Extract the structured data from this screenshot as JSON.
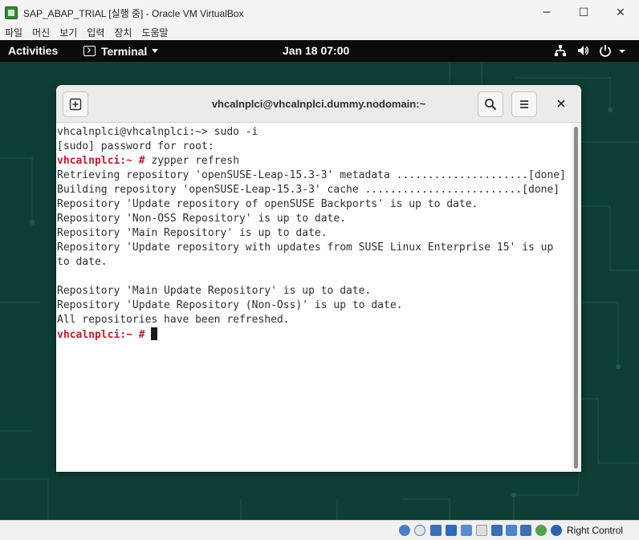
{
  "host_window": {
    "title": "SAP_ABAP_TRIAL [실행 중] - Oracle VM VirtualBox",
    "controls": {
      "minimize": "─",
      "maximize": "☐",
      "close": "✕"
    },
    "menu": [
      "파일",
      "머신",
      "보기",
      "입력",
      "장치",
      "도움말"
    ]
  },
  "gnome": {
    "activities": "Activities",
    "app_menu": "Terminal",
    "clock": "Jan 18  07:00"
  },
  "terminal": {
    "title": "vhcalnplci@vhcalnplci.dummy.nodomain:~",
    "lines": [
      {
        "prompt": "",
        "text": "vhcalnplci@vhcalnplci:~> sudo -i"
      },
      {
        "prompt": "",
        "text": "[sudo] password for root:"
      },
      {
        "prompt": "vhcalnplci:~ #",
        "text": " zypper refresh"
      },
      {
        "prompt": "",
        "text": "Retrieving repository 'openSUSE-Leap-15.3-3' metadata .....................[done]"
      },
      {
        "prompt": "",
        "text": "Building repository 'openSUSE-Leap-15.3-3' cache .........................[done]"
      },
      {
        "prompt": "",
        "text": "Repository 'Update repository of openSUSE Backports' is up to date."
      },
      {
        "prompt": "",
        "text": "Repository 'Non-OSS Repository' is up to date."
      },
      {
        "prompt": "",
        "text": "Repository 'Main Repository' is up to date."
      },
      {
        "prompt": "",
        "text": "Repository 'Update repository with updates from SUSE Linux Enterprise 15' is up"
      },
      {
        "prompt": "",
        "text": "to date."
      },
      {
        "prompt": "",
        "text": ""
      },
      {
        "prompt": "",
        "text": "Repository 'Main Update Repository' is up to date."
      },
      {
        "prompt": "",
        "text": "Repository 'Update Repository (Non-Oss)' is up to date."
      },
      {
        "prompt": "",
        "text": "All repositories have been refreshed."
      },
      {
        "prompt": "vhcalnplci:~ #",
        "text": " ",
        "cursor": true
      }
    ]
  },
  "status_bar": {
    "host_key": "Right Control"
  },
  "colors": {
    "prompt": "#c01c28",
    "desktop": "#0e3f36",
    "topbar": "#0b0b0b"
  }
}
